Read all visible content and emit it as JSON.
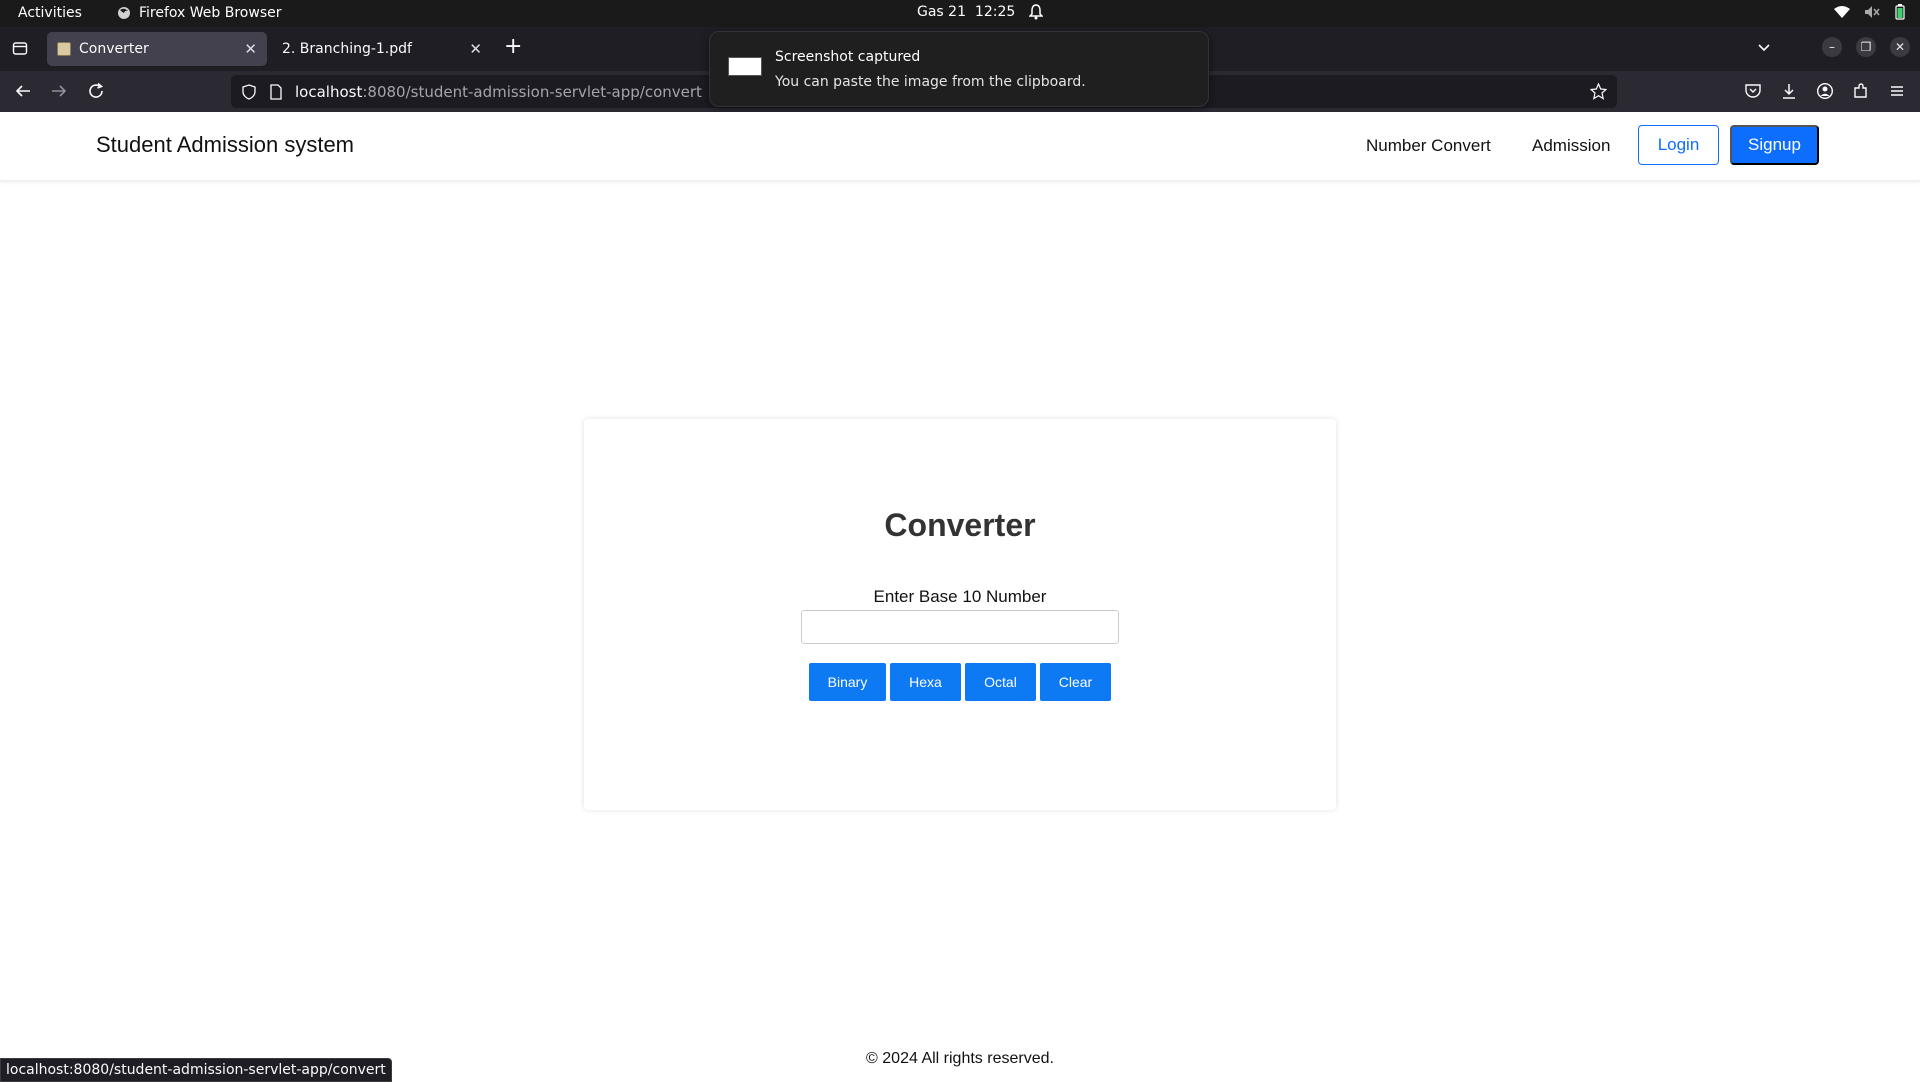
{
  "system": {
    "activities": "Activities",
    "app_name": "Firefox Web Browser",
    "date": "Gas 21",
    "time": "12:25"
  },
  "browser": {
    "tabs": [
      {
        "label": "Converter",
        "active": true
      },
      {
        "label": "2. Branching-1.pdf",
        "active": false
      }
    ],
    "url_host": "localhost",
    "url_rest": ":8080/student-admission-servlet-app/convert",
    "status_url": "localhost:8080/student-admission-servlet-app/convert"
  },
  "notification": {
    "title": "Screenshot captured",
    "body": "You can paste the image from the clipboard."
  },
  "header": {
    "brand": "Student Admission system",
    "nav": [
      "Number Convert",
      "Admission"
    ],
    "login_label": "Login",
    "signup_label": "Signup",
    "accent_color": "#0d6efd"
  },
  "converter": {
    "title": "Converter",
    "input_label": "Enter Base 10 Number",
    "input_value": "",
    "buttons": [
      "Binary",
      "Hexa",
      "Octal",
      "Clear"
    ]
  },
  "footer": {
    "text": "© 2024 All rights reserved."
  }
}
